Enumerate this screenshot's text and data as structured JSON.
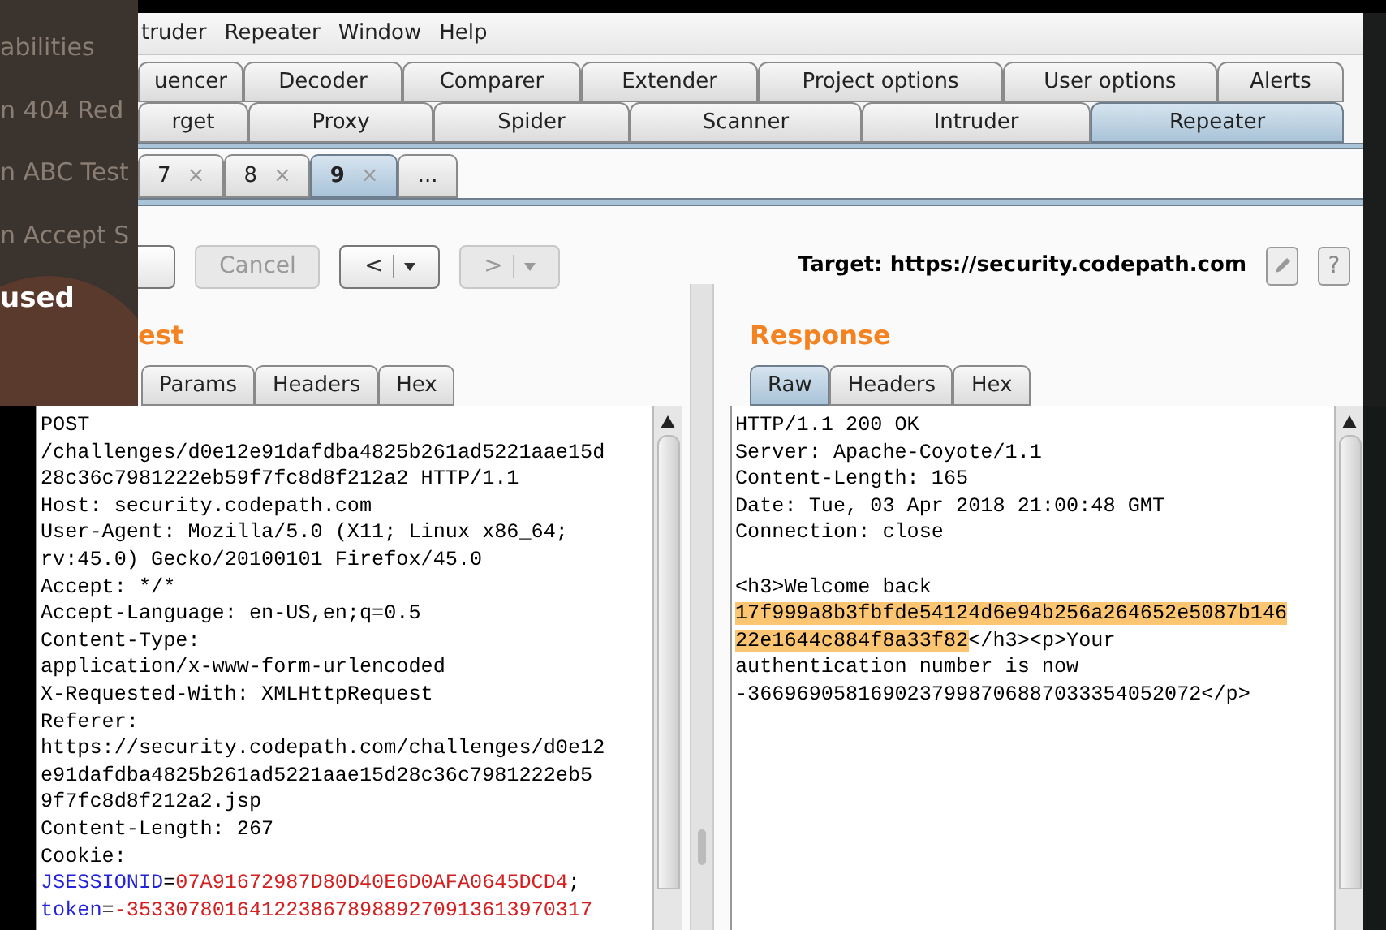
{
  "background_window": {
    "lines": [
      {
        "text": "abilities",
        "kind": "dim"
      },
      {
        "text": "n 404 Red",
        "kind": "dim"
      },
      {
        "text": "n ABC Test",
        "kind": "dim"
      },
      {
        "text": "n Accept S",
        "kind": "dim"
      },
      {
        "text": "used",
        "kind": "bright"
      }
    ]
  },
  "menu_bar": [
    "truder",
    "Repeater",
    "Window",
    "Help"
  ],
  "main_tabs": [
    [
      {
        "label": "uencer",
        "selected": false
      },
      {
        "label": "Decoder",
        "selected": false
      },
      {
        "label": "Comparer",
        "selected": false
      },
      {
        "label": "Extender",
        "selected": false
      },
      {
        "label": "Project options",
        "selected": false
      },
      {
        "label": "User options",
        "selected": false
      },
      {
        "label": "Alerts",
        "selected": false
      }
    ],
    [
      {
        "label": "rget",
        "selected": false
      },
      {
        "label": "Proxy",
        "selected": false
      },
      {
        "label": "Spider",
        "selected": false
      },
      {
        "label": "Scanner",
        "selected": false
      },
      {
        "label": "Intruder",
        "selected": false
      },
      {
        "label": "Repeater",
        "selected": true
      }
    ]
  ],
  "repeater_tabs": [
    {
      "label": "7",
      "close": "×",
      "selected": false
    },
    {
      "label": "8",
      "close": "×",
      "selected": false
    },
    {
      "label": "9",
      "close": "×",
      "selected": true
    },
    {
      "label": "...",
      "selected": false
    }
  ],
  "toolbar": {
    "buttons": [
      {
        "disabled": false
      },
      {
        "label": "Cancel",
        "disabled": true
      },
      {
        "label": "<",
        "dropdown": true,
        "disabled": false
      },
      {
        "label": ">",
        "dropdown": true,
        "disabled": true
      }
    ],
    "target": "Target: https://security.codepath.com",
    "help": "?"
  },
  "request": {
    "title": "est",
    "tabs": [
      {
        "label": "Params",
        "selected": false
      },
      {
        "label": "Headers",
        "selected": false
      },
      {
        "label": "Hex",
        "selected": false
      }
    ],
    "lines": [
      [
        {
          "text": "POST",
          "kind": "plain"
        }
      ],
      [
        {
          "text": "/challenges/d0e12e91dafdba4825b261ad5221aae15d",
          "kind": "plain"
        }
      ],
      [
        {
          "text": "28c36c7981222eb59f7fc8d8f212a2 HTTP/1.1",
          "kind": "plain"
        }
      ],
      [
        {
          "text": "Host: security.codepath.com",
          "kind": "plain"
        }
      ],
      [
        {
          "text": "User-Agent: Mozilla/5.0 (X11; Linux x86_64;",
          "kind": "plain"
        }
      ],
      [
        {
          "text": "rv:45.0) Gecko/20100101 Firefox/45.0",
          "kind": "plain"
        }
      ],
      [
        {
          "text": "Accept: */*",
          "kind": "plain"
        }
      ],
      [
        {
          "text": "Accept-Language: en-US,en;q=0.5",
          "kind": "plain"
        }
      ],
      [
        {
          "text": "Content-Type:",
          "kind": "plain"
        }
      ],
      [
        {
          "text": "application/x-www-form-urlencoded",
          "kind": "plain"
        }
      ],
      [
        {
          "text": "X-Requested-With: XMLHttpRequest",
          "kind": "plain"
        }
      ],
      [
        {
          "text": "Referer:",
          "kind": "plain"
        }
      ],
      [
        {
          "text": "https://security.codepath.com/challenges/d0e12",
          "kind": "plain"
        }
      ],
      [
        {
          "text": "e91dafdba4825b261ad5221aae15d28c36c7981222eb5",
          "kind": "plain"
        }
      ],
      [
        {
          "text": "9f7fc8d8f212a2.jsp",
          "kind": "plain"
        }
      ],
      [
        {
          "text": "Content-Length: 267",
          "kind": "plain"
        }
      ],
      [
        {
          "text": "Cookie:",
          "kind": "plain"
        }
      ],
      [
        {
          "text": "JSESSIONID",
          "kind": "name"
        },
        {
          "text": "=",
          "kind": "plain"
        },
        {
          "text": "07A91672987D80D40E6D0AFA0645DCD4",
          "kind": "value"
        },
        {
          "text": ";",
          "kind": "plain"
        }
      ],
      [
        {
          "text": "token",
          "kind": "name"
        },
        {
          "text": "=",
          "kind": "plain"
        },
        {
          "text": "-35330780164122386789889270913613970317",
          "kind": "value"
        }
      ]
    ]
  },
  "response": {
    "title": "Response",
    "tabs": [
      {
        "label": "Raw",
        "selected": true
      },
      {
        "label": "Headers",
        "selected": false
      },
      {
        "label": "Hex",
        "selected": false
      }
    ],
    "lines": [
      [
        {
          "text": "HTTP/1.1 200 OK",
          "kind": "plain"
        }
      ],
      [
        {
          "text": "Server: Apache-Coyote/1.1",
          "kind": "plain"
        }
      ],
      [
        {
          "text": "Content-Length: 165",
          "kind": "plain"
        }
      ],
      [
        {
          "text": "Date: Tue, 03 Apr 2018 21:00:48 GMT",
          "kind": "plain"
        }
      ],
      [
        {
          "text": "Connection: close",
          "kind": "plain"
        }
      ],
      {
        "kind": "blank"
      },
      [
        {
          "text": "<h3>Welcome back",
          "kind": "plain"
        }
      ],
      [
        {
          "text": "17f999a8b3fbfde54124d6e94b256a264652e5087b146",
          "kind": "highlight"
        }
      ],
      [
        {
          "text": "22e1644c884f8a33f82",
          "kind": "highlight"
        },
        {
          "text": "</h3><p>Your",
          "kind": "plain"
        }
      ],
      [
        {
          "text": "authentication number is now",
          "kind": "plain"
        }
      ],
      [
        {
          "text": "-3669690581690237998706887033354052072</p>",
          "kind": "plain"
        }
      ]
    ]
  }
}
